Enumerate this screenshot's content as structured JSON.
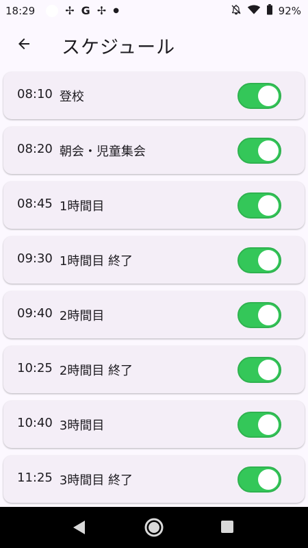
{
  "status_bar": {
    "time": "18:29",
    "battery": "92%",
    "notification_icons": [
      "pinwheel-icon",
      "google-icon",
      "pinwheel-icon",
      "dot-icon"
    ]
  },
  "header": {
    "title": "スケジュール"
  },
  "schedule": [
    {
      "time": "08:10",
      "label": "登校",
      "enabled": true
    },
    {
      "time": "08:20",
      "label": "朝会・児童集会",
      "enabled": true
    },
    {
      "time": "08:45",
      "label": "1時間目",
      "enabled": true
    },
    {
      "time": "09:30",
      "label": "1時間目 終了",
      "enabled": true
    },
    {
      "time": "09:40",
      "label": "2時間目",
      "enabled": true
    },
    {
      "time": "10:25",
      "label": "2時間目 終了",
      "enabled": true
    },
    {
      "time": "10:40",
      "label": "3時間目",
      "enabled": true
    },
    {
      "time": "11:25",
      "label": "3時間目 終了",
      "enabled": true
    }
  ],
  "colors": {
    "toggle_on": "#34c759",
    "card_bg": "#f4eef7",
    "page_bg": "#fcf8ff"
  }
}
